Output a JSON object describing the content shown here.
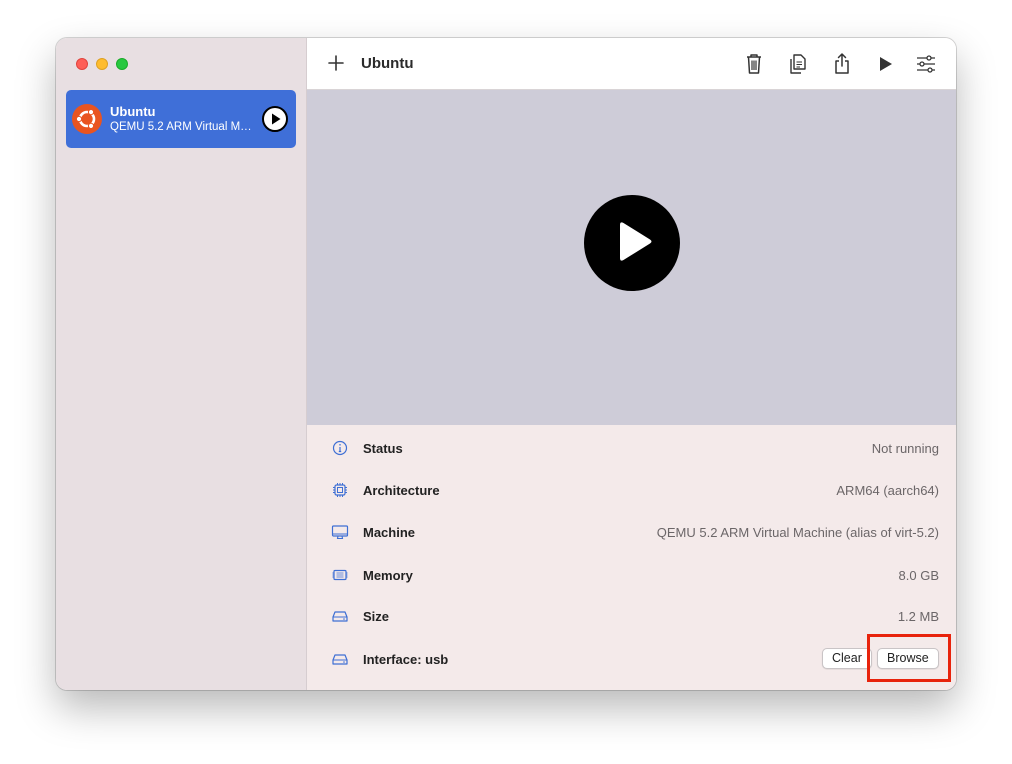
{
  "sidebar": {
    "vm": {
      "name": "Ubuntu",
      "subtitle": "QEMU 5.2 ARM Virtual Machine (alias of virt-5.2)",
      "logo_icon": "ubuntu-logo-icon",
      "play_icon": "play-circle-icon"
    }
  },
  "toolbar": {
    "title": "Ubuntu",
    "icons": [
      "plus-icon",
      "trash-icon",
      "clone-icon",
      "share-icon",
      "play-icon",
      "settings-sliders-icon"
    ]
  },
  "preview": {
    "icon": "big-play-icon"
  },
  "details": {
    "status": {
      "label": "Status",
      "value": "Not running",
      "icon": "info-icon"
    },
    "architecture": {
      "label": "Architecture",
      "value": "ARM64 (aarch64)",
      "icon": "cpu-icon"
    },
    "machine": {
      "label": "Machine",
      "value": "QEMU 5.2 ARM Virtual Machine (alias of virt-5.2)",
      "icon": "display-icon"
    },
    "memory": {
      "label": "Memory",
      "value": "8.0 GB",
      "icon": "memory-icon"
    },
    "size": {
      "label": "Size",
      "value": "1.2 MB",
      "icon": "drive-icon"
    },
    "interface": {
      "label": "Interface: usb",
      "icon": "drive-icon",
      "clear_label": "Clear",
      "browse_label": "Browse"
    }
  },
  "colors": {
    "accent": "#3f6fd8",
    "icon_blue": "#3e6fd4",
    "highlight": "#e8230c",
    "sidebar_bg": "#e8dfe2",
    "preview_bg": "#ceccd8"
  }
}
